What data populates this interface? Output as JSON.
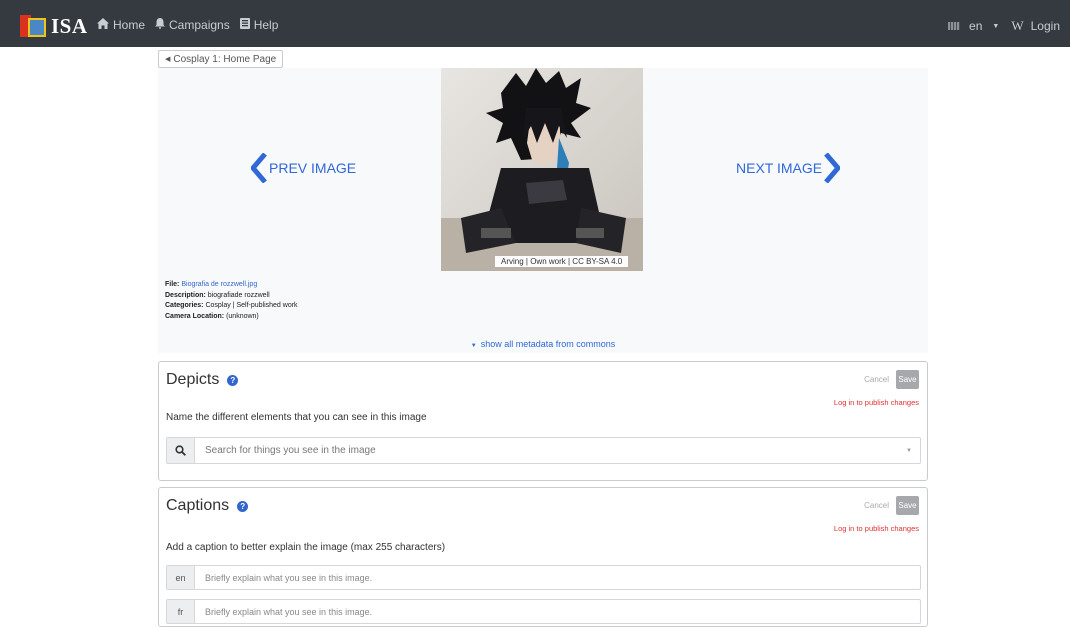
{
  "navbar": {
    "logo_text": "ISA",
    "links": [
      {
        "icon": "home-icon",
        "label": "Home"
      },
      {
        "icon": "bell-icon",
        "label": "Campaigns"
      },
      {
        "icon": "book-icon",
        "label": "Help"
      }
    ],
    "language": "en",
    "login_label": "Login"
  },
  "breadcrumb": {
    "label": "Cosplay 1: Home Page"
  },
  "viewer": {
    "prev_label": "PREV IMAGE",
    "next_label": "NEXT IMAGE",
    "attribution": "Arving | Own work | CC BY-SA 4.0",
    "file_key": "File:",
    "file_value": "Biografia de rozzwell.jpg",
    "description_key": "Description:",
    "description_value": "biografiade rozzwell",
    "categories_key": "Categories:",
    "categories_value": "Cosplay | Self-published work",
    "camera_key": "Camera Location:",
    "camera_value": "(unknown)",
    "show_metadata": "show all metadata from commons"
  },
  "depicts": {
    "title": "Depicts",
    "cancel": "Cancel",
    "save": "Save",
    "login_note": "Log in to publish changes",
    "description": "Name the different elements that you can see in this image",
    "search_placeholder": "Search for things you see in the image"
  },
  "captions": {
    "title": "Captions",
    "cancel": "Cancel",
    "save": "Save",
    "login_note": "Log in to publish changes",
    "description": "Add a caption to better explain the image (max 255 characters)",
    "rows": [
      {
        "lang": "en",
        "placeholder": "Briefly explain what you see in this image."
      },
      {
        "lang": "fr",
        "placeholder": "Briefly explain what you see in this image."
      }
    ]
  },
  "colors": {
    "navbar_bg": "#343a40",
    "link_blue": "#3068d6",
    "error_red": "#dd3333",
    "panel_bg": "#f8f9fa"
  }
}
